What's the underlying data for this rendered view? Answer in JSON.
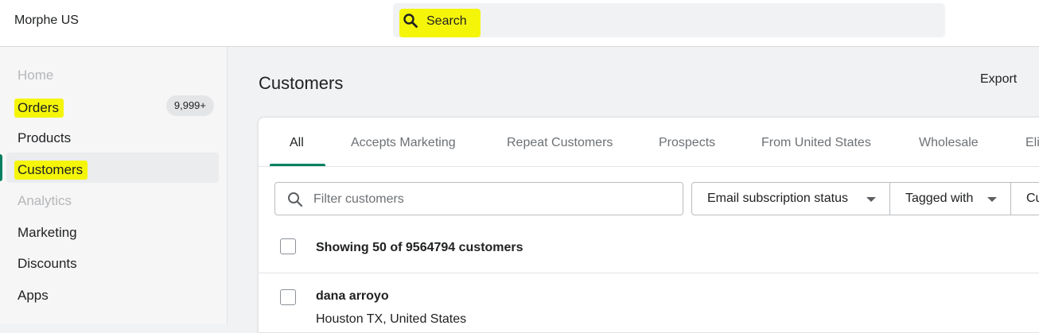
{
  "topbar": {
    "store_name": "Morphe US",
    "search": {
      "placeholder": "Search",
      "icon": "search-icon"
    }
  },
  "sidebar": {
    "items": [
      {
        "label": "Home",
        "state": "disabled"
      },
      {
        "label": "Orders",
        "badge": "9,999+",
        "highlighted": true
      },
      {
        "label": "Products"
      },
      {
        "label": "Customers",
        "state": "active",
        "highlighted": true
      },
      {
        "label": "Analytics",
        "state": "disabled"
      },
      {
        "label": "Marketing"
      },
      {
        "label": "Discounts"
      },
      {
        "label": "Apps"
      }
    ]
  },
  "page": {
    "title": "Customers",
    "export_label": "Export"
  },
  "tabs": [
    "All",
    "Accepts Marketing",
    "Repeat Customers",
    "Prospects",
    "From United States",
    "Wholesale",
    "Eli"
  ],
  "filters": {
    "search_placeholder": "Filter customers",
    "dropdowns": [
      "Email subscription status",
      "Tagged with",
      "Cu"
    ]
  },
  "list": {
    "showing_text": "Showing 50 of 9564794 customers",
    "rows": [
      {
        "name": "dana arroyo",
        "location": "Houston TX, United States"
      }
    ]
  },
  "colors": {
    "accent": "#008060",
    "highlight": "#f5f50a",
    "background": "#f1f2f3"
  }
}
